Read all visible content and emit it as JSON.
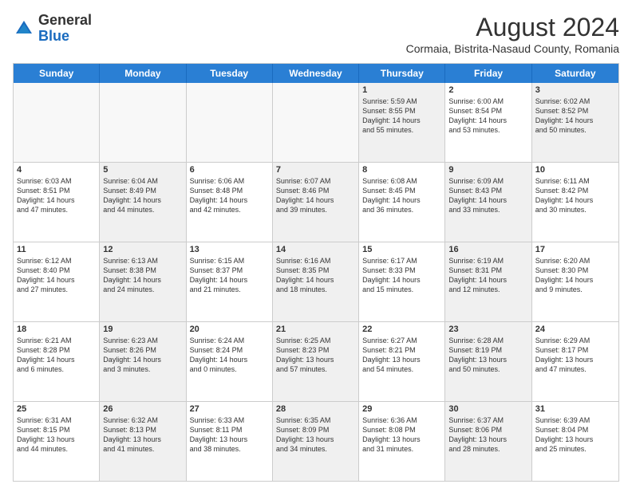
{
  "header": {
    "logo_general": "General",
    "logo_blue": "Blue",
    "month_year": "August 2024",
    "location": "Cormaia, Bistrita-Nasaud County, Romania"
  },
  "days_of_week": [
    "Sunday",
    "Monday",
    "Tuesday",
    "Wednesday",
    "Thursday",
    "Friday",
    "Saturday"
  ],
  "weeks": [
    [
      {
        "day": "",
        "text": "",
        "empty": true
      },
      {
        "day": "",
        "text": "",
        "empty": true
      },
      {
        "day": "",
        "text": "",
        "empty": true
      },
      {
        "day": "",
        "text": "",
        "empty": true
      },
      {
        "day": "1",
        "text": "Sunrise: 5:59 AM\nSunset: 8:55 PM\nDaylight: 14 hours\nand 55 minutes.",
        "empty": false,
        "shaded": true
      },
      {
        "day": "2",
        "text": "Sunrise: 6:00 AM\nSunset: 8:54 PM\nDaylight: 14 hours\nand 53 minutes.",
        "empty": false,
        "shaded": false
      },
      {
        "day": "3",
        "text": "Sunrise: 6:02 AM\nSunset: 8:52 PM\nDaylight: 14 hours\nand 50 minutes.",
        "empty": false,
        "shaded": true
      }
    ],
    [
      {
        "day": "4",
        "text": "Sunrise: 6:03 AM\nSunset: 8:51 PM\nDaylight: 14 hours\nand 47 minutes.",
        "empty": false,
        "shaded": false
      },
      {
        "day": "5",
        "text": "Sunrise: 6:04 AM\nSunset: 8:49 PM\nDaylight: 14 hours\nand 44 minutes.",
        "empty": false,
        "shaded": true
      },
      {
        "day": "6",
        "text": "Sunrise: 6:06 AM\nSunset: 8:48 PM\nDaylight: 14 hours\nand 42 minutes.",
        "empty": false,
        "shaded": false
      },
      {
        "day": "7",
        "text": "Sunrise: 6:07 AM\nSunset: 8:46 PM\nDaylight: 14 hours\nand 39 minutes.",
        "empty": false,
        "shaded": true
      },
      {
        "day": "8",
        "text": "Sunrise: 6:08 AM\nSunset: 8:45 PM\nDaylight: 14 hours\nand 36 minutes.",
        "empty": false,
        "shaded": false
      },
      {
        "day": "9",
        "text": "Sunrise: 6:09 AM\nSunset: 8:43 PM\nDaylight: 14 hours\nand 33 minutes.",
        "empty": false,
        "shaded": true
      },
      {
        "day": "10",
        "text": "Sunrise: 6:11 AM\nSunset: 8:42 PM\nDaylight: 14 hours\nand 30 minutes.",
        "empty": false,
        "shaded": false
      }
    ],
    [
      {
        "day": "11",
        "text": "Sunrise: 6:12 AM\nSunset: 8:40 PM\nDaylight: 14 hours\nand 27 minutes.",
        "empty": false,
        "shaded": false
      },
      {
        "day": "12",
        "text": "Sunrise: 6:13 AM\nSunset: 8:38 PM\nDaylight: 14 hours\nand 24 minutes.",
        "empty": false,
        "shaded": true
      },
      {
        "day": "13",
        "text": "Sunrise: 6:15 AM\nSunset: 8:37 PM\nDaylight: 14 hours\nand 21 minutes.",
        "empty": false,
        "shaded": false
      },
      {
        "day": "14",
        "text": "Sunrise: 6:16 AM\nSunset: 8:35 PM\nDaylight: 14 hours\nand 18 minutes.",
        "empty": false,
        "shaded": true
      },
      {
        "day": "15",
        "text": "Sunrise: 6:17 AM\nSunset: 8:33 PM\nDaylight: 14 hours\nand 15 minutes.",
        "empty": false,
        "shaded": false
      },
      {
        "day": "16",
        "text": "Sunrise: 6:19 AM\nSunset: 8:31 PM\nDaylight: 14 hours\nand 12 minutes.",
        "empty": false,
        "shaded": true
      },
      {
        "day": "17",
        "text": "Sunrise: 6:20 AM\nSunset: 8:30 PM\nDaylight: 14 hours\nand 9 minutes.",
        "empty": false,
        "shaded": false
      }
    ],
    [
      {
        "day": "18",
        "text": "Sunrise: 6:21 AM\nSunset: 8:28 PM\nDaylight: 14 hours\nand 6 minutes.",
        "empty": false,
        "shaded": false
      },
      {
        "day": "19",
        "text": "Sunrise: 6:23 AM\nSunset: 8:26 PM\nDaylight: 14 hours\nand 3 minutes.",
        "empty": false,
        "shaded": true
      },
      {
        "day": "20",
        "text": "Sunrise: 6:24 AM\nSunset: 8:24 PM\nDaylight: 14 hours\nand 0 minutes.",
        "empty": false,
        "shaded": false
      },
      {
        "day": "21",
        "text": "Sunrise: 6:25 AM\nSunset: 8:23 PM\nDaylight: 13 hours\nand 57 minutes.",
        "empty": false,
        "shaded": true
      },
      {
        "day": "22",
        "text": "Sunrise: 6:27 AM\nSunset: 8:21 PM\nDaylight: 13 hours\nand 54 minutes.",
        "empty": false,
        "shaded": false
      },
      {
        "day": "23",
        "text": "Sunrise: 6:28 AM\nSunset: 8:19 PM\nDaylight: 13 hours\nand 50 minutes.",
        "empty": false,
        "shaded": true
      },
      {
        "day": "24",
        "text": "Sunrise: 6:29 AM\nSunset: 8:17 PM\nDaylight: 13 hours\nand 47 minutes.",
        "empty": false,
        "shaded": false
      }
    ],
    [
      {
        "day": "25",
        "text": "Sunrise: 6:31 AM\nSunset: 8:15 PM\nDaylight: 13 hours\nand 44 minutes.",
        "empty": false,
        "shaded": false
      },
      {
        "day": "26",
        "text": "Sunrise: 6:32 AM\nSunset: 8:13 PM\nDaylight: 13 hours\nand 41 minutes.",
        "empty": false,
        "shaded": true
      },
      {
        "day": "27",
        "text": "Sunrise: 6:33 AM\nSunset: 8:11 PM\nDaylight: 13 hours\nand 38 minutes.",
        "empty": false,
        "shaded": false
      },
      {
        "day": "28",
        "text": "Sunrise: 6:35 AM\nSunset: 8:09 PM\nDaylight: 13 hours\nand 34 minutes.",
        "empty": false,
        "shaded": true
      },
      {
        "day": "29",
        "text": "Sunrise: 6:36 AM\nSunset: 8:08 PM\nDaylight: 13 hours\nand 31 minutes.",
        "empty": false,
        "shaded": false
      },
      {
        "day": "30",
        "text": "Sunrise: 6:37 AM\nSunset: 8:06 PM\nDaylight: 13 hours\nand 28 minutes.",
        "empty": false,
        "shaded": true
      },
      {
        "day": "31",
        "text": "Sunrise: 6:39 AM\nSunset: 8:04 PM\nDaylight: 13 hours\nand 25 minutes.",
        "empty": false,
        "shaded": false
      }
    ]
  ]
}
